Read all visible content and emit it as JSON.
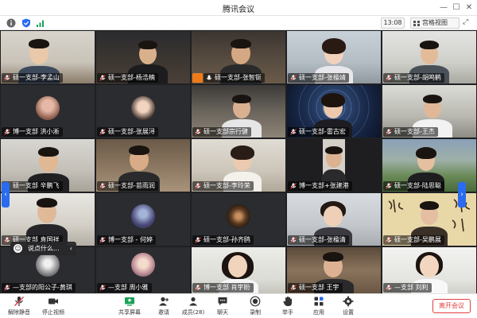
{
  "window": {
    "title": "腾讯会议"
  },
  "top_toolbar": {
    "time": "13:08",
    "view_mode": "宫格视图"
  },
  "participants": [
    {
      "name": "硕一支部-李孟山"
    },
    {
      "name": "硕一支部-杨浩楠"
    },
    {
      "name": "硕一支部-张智铤"
    },
    {
      "name": "硕一支部-张楹靖"
    },
    {
      "name": "硕一支部-胡鸣鹤"
    },
    {
      "name": "博一支部 洪小淅"
    },
    {
      "name": "硕一支部-张展浔"
    },
    {
      "name": "硕一支部宗行健"
    },
    {
      "name": "硕一支部-雷古宏"
    },
    {
      "name": "硕一支部-王杰"
    },
    {
      "name": "硕一支部 辛鹏飞"
    },
    {
      "name": "硕一支部-苗雨润"
    },
    {
      "name": "硕一支部-李玲荣"
    },
    {
      "name": "博一支部+张建港"
    },
    {
      "name": "硕一支部-陆思聪"
    },
    {
      "name": "研一支部 袁国祥"
    },
    {
      "name": "博一支部 - 何婷"
    },
    {
      "name": "硕一支部-孙齐鸥"
    },
    {
      "name": "硕一支部-张楹清"
    },
    {
      "name": "硕一支部-吴鹏展"
    },
    {
      "name": "—支部的阳公子-黄琪"
    },
    {
      "name": "—支部 周小雅"
    },
    {
      "name": "博一支部 肖宇盼"
    },
    {
      "name": "硕一支部 王宇"
    },
    {
      "name": "—支部 刘利"
    }
  ],
  "chat_popup": {
    "placeholder": "说点什么..."
  },
  "bottom_bar": {
    "unmute": "解除静音",
    "stop_video": "停止视频",
    "share_screen": "共享屏幕",
    "invite": "邀请",
    "members": "成员(28)",
    "chat": "聊天",
    "record": "录制",
    "raise_hand": "举手",
    "apps": "应用",
    "settings": "设置",
    "leave": "离开会议"
  },
  "colors": {
    "leave": "#e04040",
    "share": "#18a058",
    "accent": "#2a6bf0"
  },
  "icons": [
    "info-icon",
    "shield-icon",
    "signal-icon",
    "grid-icon",
    "fullscreen-icon",
    "mic-muted-icon",
    "video-icon",
    "share-screen-icon",
    "invite-icon",
    "members-icon",
    "chat-icon",
    "record-icon",
    "hand-icon",
    "apps-icon",
    "settings-icon"
  ]
}
